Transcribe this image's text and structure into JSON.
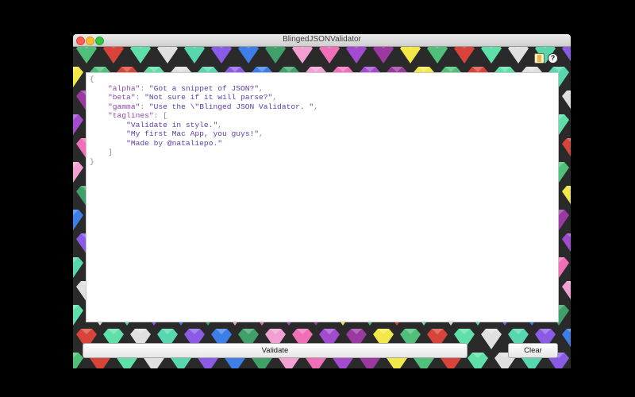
{
  "window": {
    "title": "BlingedJSONValidator"
  },
  "toolbar": {
    "book_icon": "book-icon",
    "help_icon": "help-icon",
    "help_glyph": "?"
  },
  "editor": {
    "lines": [
      [
        [
          "p",
          "{"
        ]
      ],
      [
        [
          "p",
          "    "
        ],
        [
          "k",
          "\"alpha\""
        ],
        [
          "p",
          ": "
        ],
        [
          "s",
          "\"Got a snippet of JSON?\""
        ],
        [
          "p",
          ","
        ]
      ],
      [
        [
          "p",
          "    "
        ],
        [
          "k",
          "\"beta\""
        ],
        [
          "p",
          ": "
        ],
        [
          "s",
          "\"Not sure if it will parse?\""
        ],
        [
          "p",
          ","
        ]
      ],
      [
        [
          "p",
          "    "
        ],
        [
          "k",
          "\"gamma\""
        ],
        [
          "p",
          ": "
        ],
        [
          "s",
          "\"Use the \\\"Blinged JSON Validator. \""
        ],
        [
          "p",
          ","
        ]
      ],
      [
        [
          "p",
          "    "
        ],
        [
          "k",
          "\"taglines\""
        ],
        [
          "p",
          ": ["
        ]
      ],
      [
        [
          "p",
          "        "
        ],
        [
          "s",
          "\"Validate in style.\""
        ],
        [
          "p",
          ","
        ]
      ],
      [
        [
          "p",
          "        "
        ],
        [
          "s",
          "\"My first Mac App, you guys!\""
        ],
        [
          "p",
          ","
        ]
      ],
      [
        [
          "p",
          "        "
        ],
        [
          "s",
          "\"Made by @nataliepo.\""
        ]
      ],
      [
        [
          "p",
          "    ]"
        ]
      ],
      [
        [
          "p",
          "}"
        ]
      ]
    ]
  },
  "buttons": {
    "validate": "Validate",
    "clear": "Clear"
  },
  "colors": {
    "gem_palette": [
      "#4fbf7a",
      "#5fe0a8",
      "#58d6b0",
      "#3e7ee8",
      "#f2a0d2",
      "#a24bd0",
      "#f2e84a",
      "#d9443a",
      "#e0e0e0",
      "#8a5ce6",
      "#3fa06a",
      "#f070b8",
      "#9a3aa0"
    ]
  }
}
